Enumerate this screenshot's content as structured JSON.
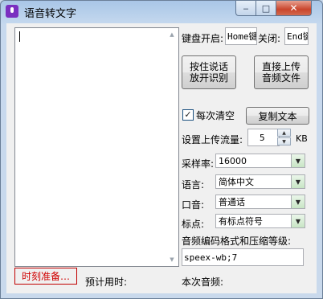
{
  "window": {
    "title": "语音转文字",
    "controls": {
      "minimize": "‒",
      "maximize": "□",
      "close": "✕"
    }
  },
  "transcript": {
    "value": ""
  },
  "keyboard": {
    "start_label": "键盘开启:",
    "start_value": "Home键",
    "close_label": "关闭:",
    "close_value": "End键"
  },
  "actions": {
    "hold_to_talk": "按住说话\n放开识别",
    "upload_audio": "直接上传\n音频文件"
  },
  "auto_clear": {
    "label": "每次清空",
    "checked": true
  },
  "copy_button": "复制文本",
  "upload_rate": {
    "label": "设置上传流量:",
    "value": "5",
    "unit": "KB"
  },
  "settings": [
    {
      "label": "采样率:",
      "value": "16000"
    },
    {
      "label": "语言:",
      "value": "简体中文"
    },
    {
      "label": "口音:",
      "value": "普通话"
    },
    {
      "label": "标点:",
      "value": "有标点符号"
    }
  ],
  "codec": {
    "label": "音频编码格式和压缩等级:",
    "value": "speex-wb;7"
  },
  "status": {
    "timer": "时刻准备…",
    "estimated_time_label": "预计用时:",
    "current_audio_label": "本次音频:"
  },
  "colors": {
    "status_red": "#d00000",
    "dropdown_green": "#c8e6c5"
  }
}
